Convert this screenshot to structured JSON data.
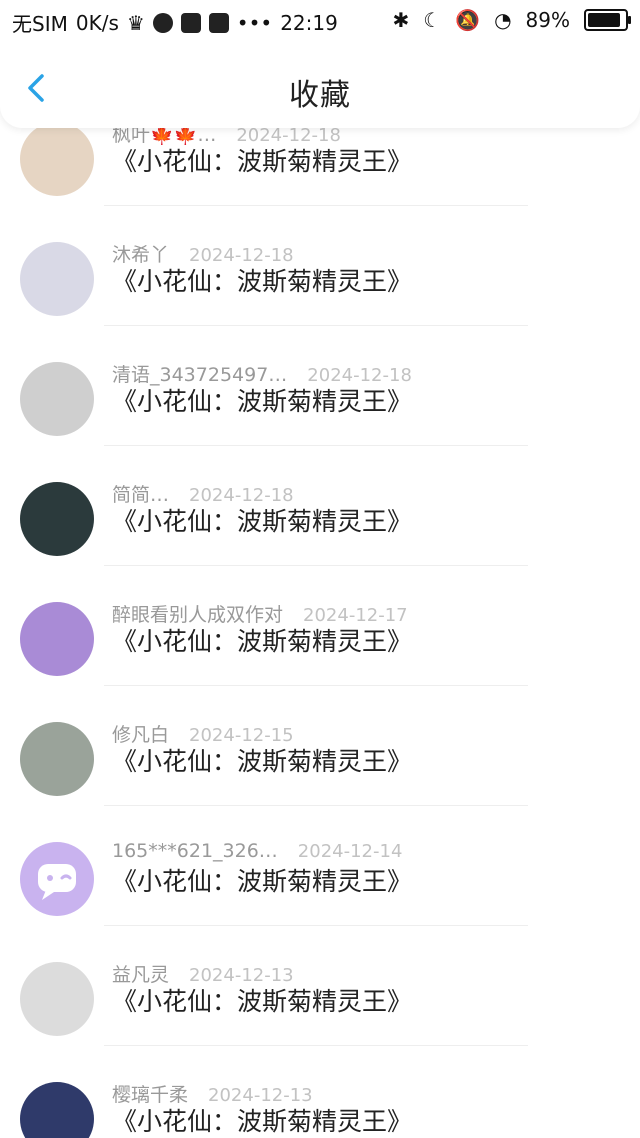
{
  "status_bar": {
    "carrier": "无SIM",
    "speed": "0K/s",
    "time": "22:19",
    "battery": "89%"
  },
  "nav": {
    "title": "收藏"
  },
  "items": [
    {
      "name": "枫叶🍁🍁…",
      "date": "2024-12-18",
      "title": "《小花仙：波斯菊精灵王》",
      "avatar_color": "#e6d5c3"
    },
    {
      "name": "沐希丫",
      "date": "2024-12-18",
      "title": "《小花仙：波斯菊精灵王》",
      "avatar_color": "#d9d9e6"
    },
    {
      "name": "清语_343725497…",
      "date": "2024-12-18",
      "title": "《小花仙：波斯菊精灵王》",
      "avatar_color": "#cfcfcf"
    },
    {
      "name": "简简…",
      "date": "2024-12-18",
      "title": "《小花仙：波斯菊精灵王》",
      "avatar_color": "#2b3a3c"
    },
    {
      "name": "醉眼看别人成双作对",
      "date": "2024-12-17",
      "title": "《小花仙：波斯菊精灵王》",
      "avatar_color": "#a98bd6"
    },
    {
      "name": "修凡白",
      "date": "2024-12-15",
      "title": "《小花仙：波斯菊精灵王》",
      "avatar_color": "#9aa39a"
    },
    {
      "name": "165***621_326…",
      "date": "2024-12-14",
      "title": "《小花仙：波斯菊精灵王》",
      "avatar_color": "#c9b3ef"
    },
    {
      "name": "益凡灵",
      "date": "2024-12-13",
      "title": "《小花仙：波斯菊精灵王》",
      "avatar_color": "#dcdcdc"
    },
    {
      "name": "樱璃千柔",
      "date": "2024-12-13",
      "title": "《小花仙：波斯菊精灵王》",
      "avatar_color": "#2f3a6a"
    }
  ]
}
